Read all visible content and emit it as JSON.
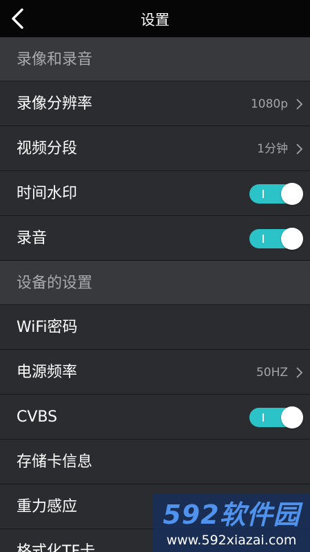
{
  "header": {
    "title": "设置"
  },
  "sections": [
    {
      "title": "录像和录音",
      "rows": [
        {
          "label": "录像分辨率",
          "value": "1080p",
          "type": "select"
        },
        {
          "label": "视频分段",
          "value": "1分钟",
          "type": "select"
        },
        {
          "label": "时间水印",
          "type": "toggle",
          "state": "on"
        },
        {
          "label": "录音",
          "type": "toggle",
          "state": "on"
        }
      ]
    },
    {
      "title": "设备的设置",
      "rows": [
        {
          "label": "WiFi密码",
          "type": "link"
        },
        {
          "label": "电源频率",
          "value": "50HZ",
          "type": "select"
        },
        {
          "label": "CVBS",
          "type": "toggle",
          "state": "on"
        },
        {
          "label": "存储卡信息",
          "type": "link"
        },
        {
          "label": "重力感应",
          "type": "select"
        },
        {
          "label": "格式化TF卡",
          "type": "link"
        }
      ]
    }
  ],
  "watermark": {
    "brand": "592软件园",
    "url": "www.592xiazai.com"
  },
  "colors": {
    "accent": "#2bc3c7",
    "titlebar": "#060606",
    "row_background": "#2b2c30",
    "section_background": "#38393d"
  }
}
